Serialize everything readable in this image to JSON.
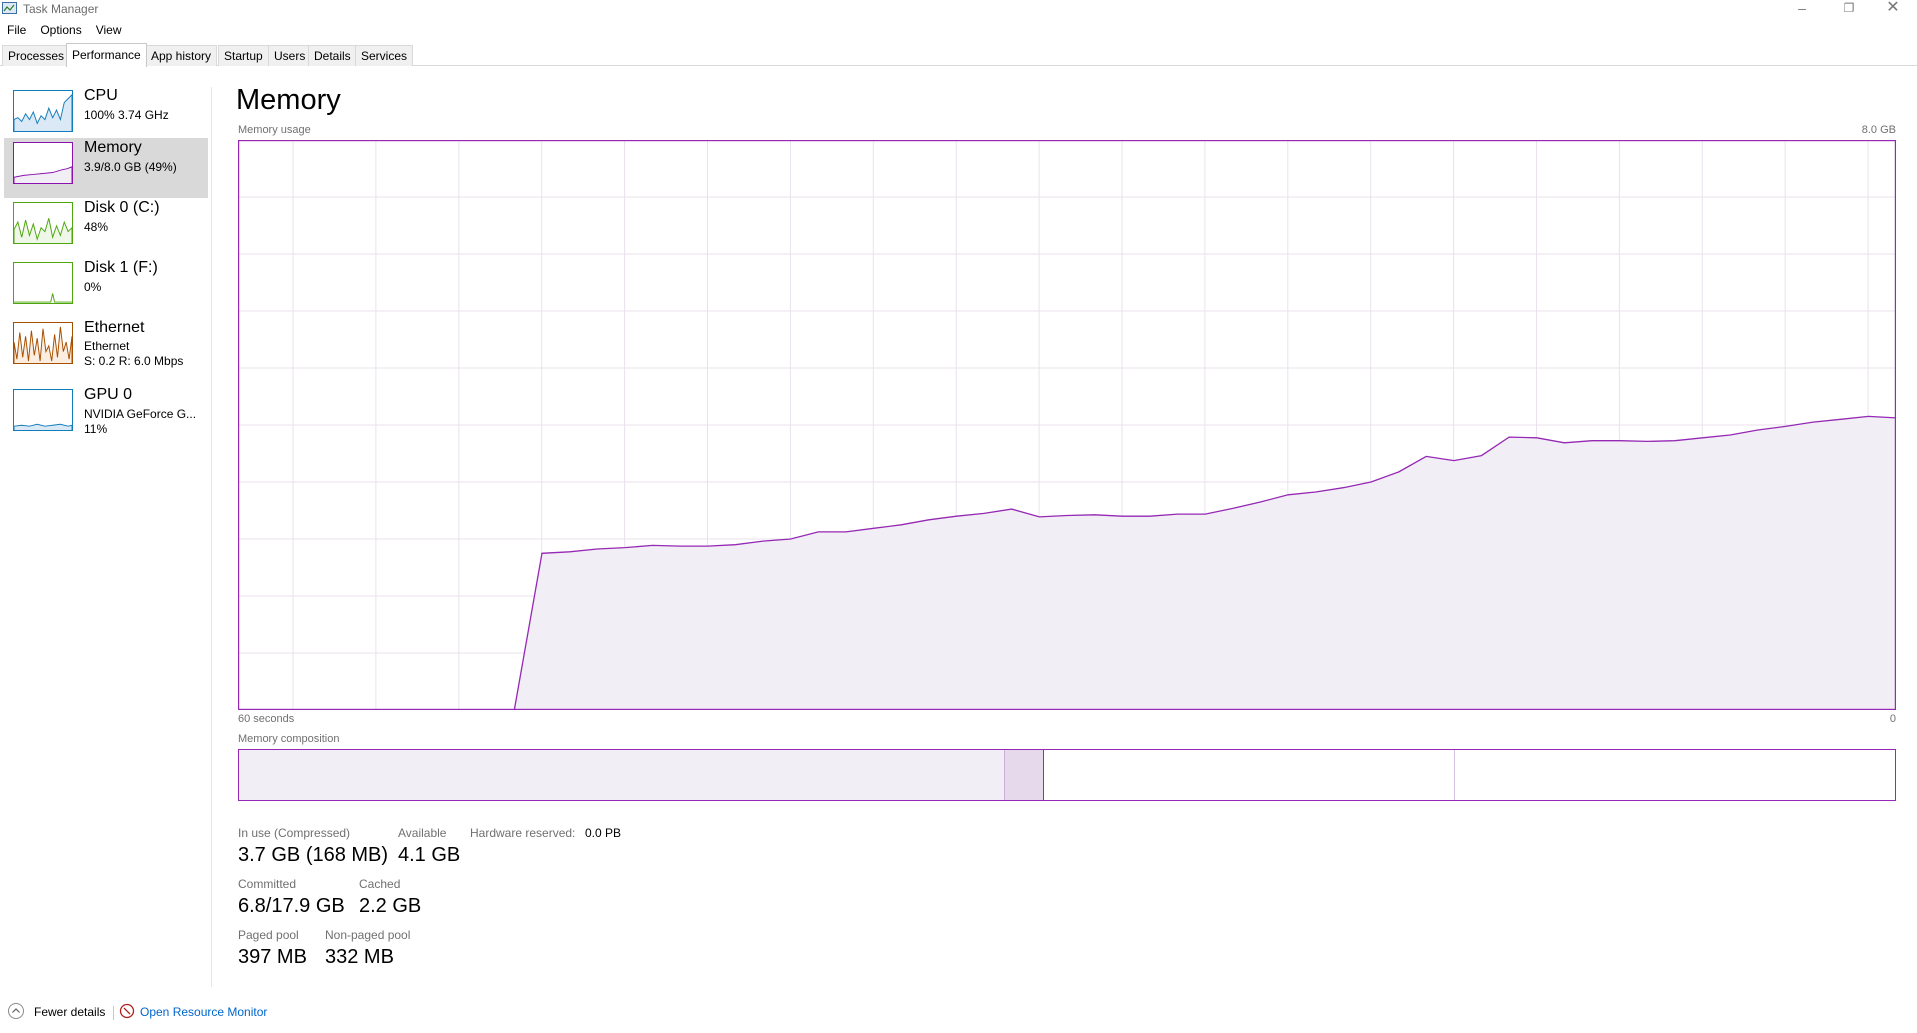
{
  "window": {
    "title": "Task Manager"
  },
  "menu": [
    "File",
    "Options",
    "View"
  ],
  "tabs": [
    "Processes",
    "Performance",
    "App history",
    "Startup",
    "Users",
    "Details",
    "Services"
  ],
  "sidebar": {
    "items": [
      {
        "name": "CPU",
        "line1": "100%  3.74 GHz",
        "line2": "",
        "color": "#117dbb"
      },
      {
        "name": "Memory",
        "line1": "3.9/8.0 GB (49%)",
        "line2": "",
        "color": "#8b12ae"
      },
      {
        "name": "Disk 0 (C:)",
        "line1": "48%",
        "line2": "",
        "color": "#4da60c"
      },
      {
        "name": "Disk 1 (F:)",
        "line1": "0%",
        "line2": "",
        "color": "#4da60c"
      },
      {
        "name": "Ethernet",
        "line1": "Ethernet",
        "line2": "S: 0.2  R: 6.0 Mbps",
        "color": "#a74f01"
      },
      {
        "name": "GPU 0",
        "line1": "NVIDIA GeForce G...",
        "line2": "11%",
        "color": "#117dbb"
      }
    ]
  },
  "main": {
    "title": "Memory",
    "usage_label": "Memory usage",
    "usage_max": "8.0 GB",
    "time_left": "60 seconds",
    "time_right": "0",
    "composition_label": "Memory composition",
    "memory_usage_series": {
      "y_unit": "GB",
      "y_range": [
        0,
        8
      ],
      "x_range_seconds": [
        60,
        0
      ],
      "values": [
        0,
        0,
        0,
        0,
        0,
        0,
        0,
        0,
        0,
        0,
        0,
        2.2,
        2.22,
        2.26,
        2.28,
        2.31,
        2.3,
        2.3,
        2.32,
        2.37,
        2.4,
        2.5,
        2.5,
        2.55,
        2.6,
        2.67,
        2.72,
        2.76,
        2.82,
        2.71,
        2.73,
        2.74,
        2.72,
        2.72,
        2.75,
        2.75,
        2.83,
        2.92,
        3.02,
        3.06,
        3.12,
        3.2,
        3.34,
        3.56,
        3.5,
        3.57,
        3.83,
        3.82,
        3.75,
        3.78,
        3.78,
        3.77,
        3.78,
        3.82,
        3.86,
        3.93,
        3.98,
        4.04,
        4.08,
        4.12,
        4.1
      ]
    },
    "composition": {
      "in_use_fraction": 0.462,
      "modified_fraction": 0.024,
      "standby_fraction": 0.248,
      "free_fraction": 0.266
    },
    "stats": {
      "in_use_label": "In use (Compressed)",
      "in_use_value": "3.7 GB (168 MB)",
      "available_label": "Available",
      "available_value": "4.1 GB",
      "hw_reserved_label": "Hardware reserved:",
      "hw_reserved_value": "0.0 PB",
      "committed_label": "Committed",
      "committed_value": "6.8/17.9 GB",
      "cached_label": "Cached",
      "cached_value": "2.2 GB",
      "paged_label": "Paged pool",
      "paged_value": "397 MB",
      "nonpaged_label": "Non-paged pool",
      "nonpaged_value": "332 MB"
    }
  },
  "footer": {
    "fewer_details": "Fewer details",
    "open_monitor": "Open Resource Monitor"
  },
  "colors": {
    "memory": "#9528b4",
    "memory_fill": "#f2eef5",
    "grid": "#e9e2ec"
  }
}
